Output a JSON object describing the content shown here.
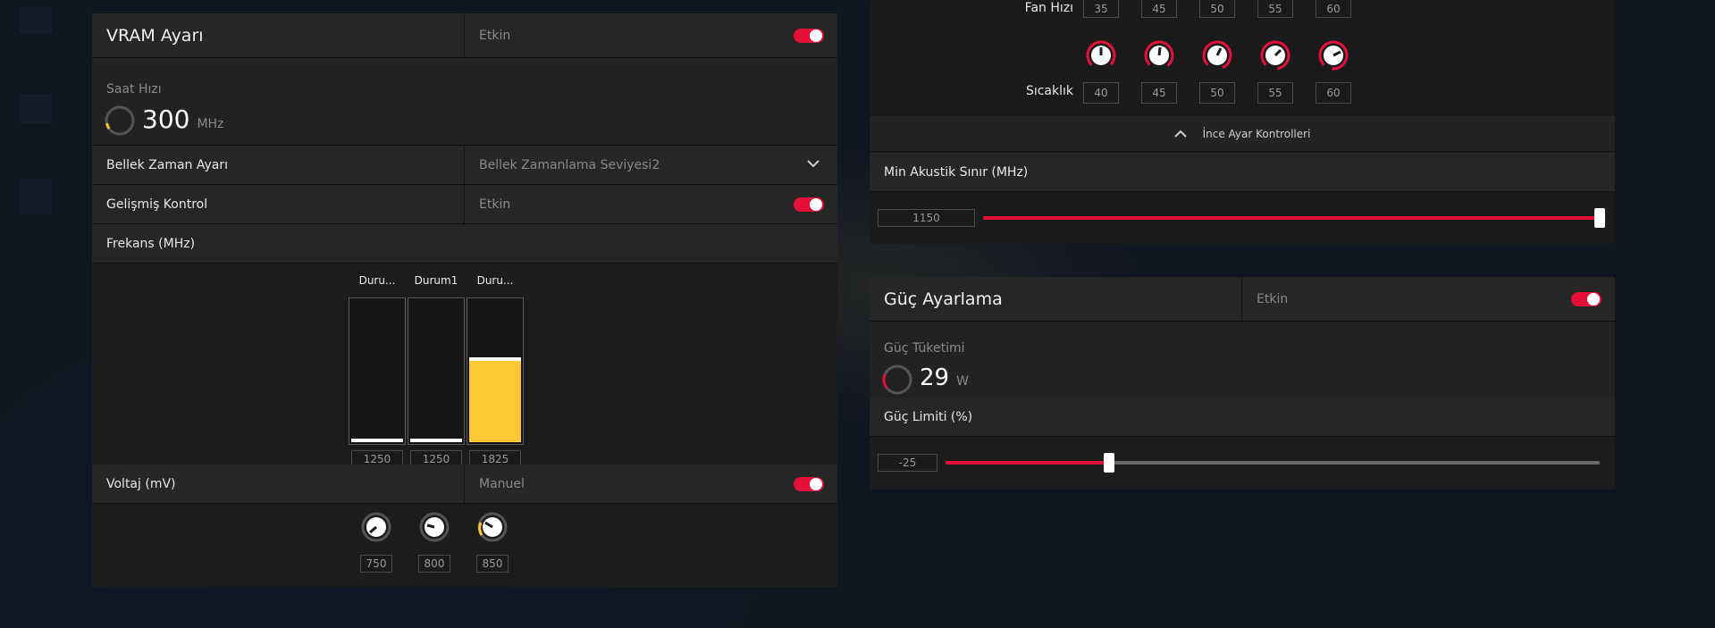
{
  "colors": {
    "accent": "#e4103a",
    "yellow": "#fdc834",
    "panel": "#1c1c1c"
  },
  "vram": {
    "title": "VRAM Ayarı",
    "status": "Etkin",
    "clock": {
      "label": "Saat Hızı",
      "value": "300",
      "unit": "MHz",
      "gauge_fraction": 0.2
    },
    "memory_timing": {
      "label": "Bellek Zaman Ayarı",
      "value": "Bellek Zamanlama Seviyesi2"
    },
    "advanced": {
      "label": "Gelişmiş Kontrol",
      "status": "Etkin"
    },
    "frequency": {
      "label": "Frekans (MHz)",
      "states": [
        {
          "name": "Duru...",
          "value": "1250",
          "fill": 0
        },
        {
          "name": "Durum1",
          "value": "1250",
          "fill": 0
        },
        {
          "name": "Duru...",
          "value": "1825",
          "fill": 0.6
        }
      ]
    },
    "voltage": {
      "label": "Voltaj (mV)",
      "mode": "Manuel",
      "values": [
        "750",
        "800",
        "850"
      ]
    }
  },
  "fan": {
    "fan_speed_label": "Fan Hızı",
    "fan_speeds": [
      "35",
      "45",
      "50",
      "55",
      "60"
    ],
    "temperature_label": "Sıcaklık",
    "temperatures": [
      "40",
      "45",
      "50",
      "55",
      "60"
    ],
    "fine_tune_label": "İnce Ayar Kontrolleri",
    "min_acoustic": {
      "label": "Min Akustik Sınır (MHz)",
      "value": "1150",
      "fraction": 1.0
    }
  },
  "power": {
    "title": "Güç Ayarlama",
    "status": "Etkin",
    "consumption": {
      "label": "Güç Tüketimi",
      "value": "29",
      "unit": "W",
      "gauge_fraction": 0.1
    },
    "limit": {
      "label": "Güç Limiti (%)",
      "value": "-25",
      "fraction": 0.25
    }
  }
}
